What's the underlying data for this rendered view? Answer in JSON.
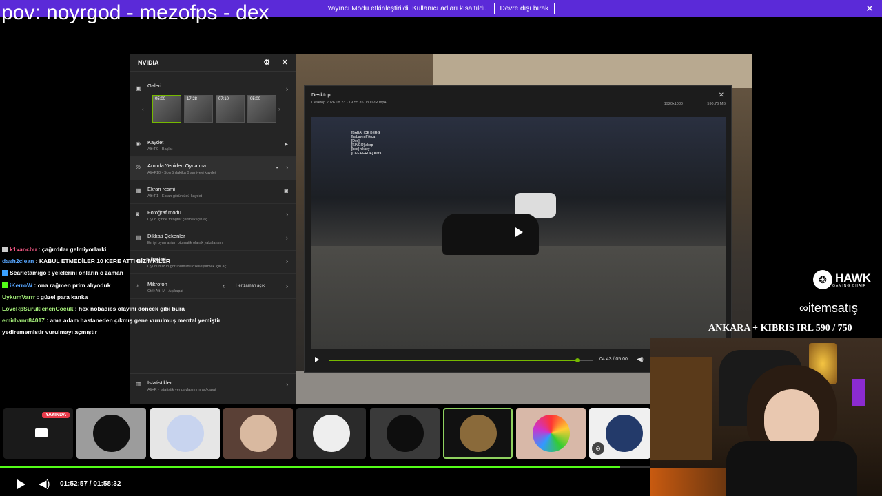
{
  "banner": {
    "text": "Yayıncı Modu etkinleştirildi. Kullanıcı adları kısaltıldı.",
    "button": "Devre dışı bırak"
  },
  "stream_title": "pov: noyrgod - mezofps - dex",
  "nvidia": {
    "title": "NVIDIA",
    "gallery": {
      "label": "Galeri",
      "thumbs": [
        "05:00",
        "17:28",
        "07:10",
        "05:00"
      ]
    },
    "items": [
      {
        "title": "Kaydet",
        "sub": "Alt+F9 - Başlat"
      },
      {
        "title": "Anında Yeniden Oynatma",
        "sub": "Alt+F10 - Son 5 dakika 0 saniyeyi kaydet"
      },
      {
        "title": "Ekran resmi",
        "sub": "Alt+F1 - Ekran görüntüsü kaydet"
      },
      {
        "title": "Fotoğraf modu",
        "sub": "Oyun içinde fotoğraf çekmek için aç"
      },
      {
        "title": "Dikkati Çekenler",
        "sub": "En iyi oyun anları otomatik olarak yakalansın"
      },
      {
        "title": "Filtreleri",
        "sub": "Oyununuzun görünümünü özelleştirmek için aç"
      }
    ],
    "mic": {
      "title": "Mikrofon",
      "sub": "Ctrl+Alt+M - Aç/kapat",
      "value": "Her zaman açık"
    },
    "stats": {
      "title": "İstatistikler",
      "sub": "Alt+R - İstatistik yer paylaşımını aç/kapat"
    }
  },
  "player": {
    "title": "Desktop",
    "file": "Desktop 2026.08.23 - 19.55.35.03.DVR.mp4",
    "resolution": "1920x1080",
    "size": "590.76 MB",
    "time": "04:43 / 05:00",
    "progress": 0.943,
    "names": [
      "[BABA] ICE BERG",
      "[babayım] Yeca",
      "[Dex]",
      "[KINGO] alorp",
      "[bex] nikkey",
      "[CEF PERDE] Kara"
    ]
  },
  "chat": [
    {
      "user": "k1vancbu",
      "msg": "çağırdılar gelmiyorlarki",
      "color": "#ff5c8a",
      "badge": "#cccccc"
    },
    {
      "user": "dash2clean",
      "msg": "KABUL ETMEDİLER 10 KERE ATTI BİZİMKİLER",
      "color": "#57a6ff",
      "badge": ""
    },
    {
      "user": "Scarletamigo",
      "msg": "yelelerini onların o zaman",
      "color": "#ffffff",
      "badge": "#3aa0ff"
    },
    {
      "user": "iKerroW",
      "msg": "ona rağmen prim alıyoduk",
      "color": "#57a6ff",
      "badge": "#53fc18"
    },
    {
      "user": "UykumVarrr",
      "msg": "güzel para kanka",
      "color": "#a6f07a",
      "badge": ""
    },
    {
      "user": "LoveRpSuruklenenCocuk",
      "msg": "hex nobadies olayını doncek gibi bura",
      "color": "#a6f07a",
      "badge": ""
    },
    {
      "user": "emirhann84017",
      "msg": "ama adam hastaneden çıkmış gene vurulmuş mental yemiştir",
      "color": "#a6f07a",
      "badge": ""
    },
    {
      "user": "",
      "msg": "yedirememistir vurulmayı açmıştır",
      "color": "#ffffff",
      "badge": ""
    }
  ],
  "sponsors": {
    "hawk": "HAWK",
    "hawk_sub": "GAMING CHAIR",
    "itemsatis": "itemsatış",
    "ankara": "ANKARA + KIBRIS IRL 590 / 750"
  },
  "strip": {
    "live_label": "YAYINDA"
  },
  "playback": {
    "time": "01:52:57 / 01:58:32",
    "progress": 0.953
  }
}
